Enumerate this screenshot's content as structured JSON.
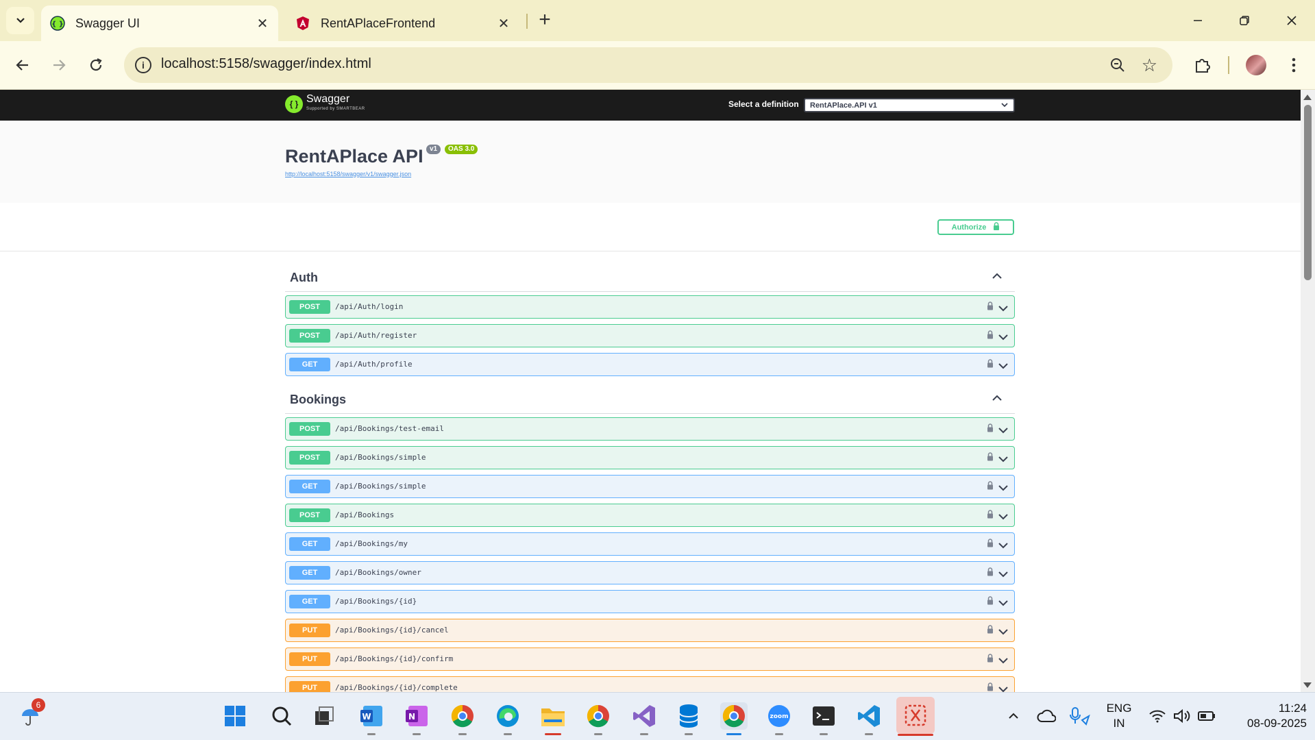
{
  "browser": {
    "tabs": [
      {
        "title": "Swagger UI",
        "active": true,
        "close": "✕"
      },
      {
        "title": "RentAPlaceFrontend",
        "active": false,
        "close": "✕"
      }
    ],
    "url": "localhost:5158/swagger/index.html",
    "new_tab": "+"
  },
  "swagger": {
    "logo_text": "Swagger",
    "logo_sub": "Supported by SMARTBEAR",
    "definition_label": "Select a definition",
    "definition_value": "RentAPlace.API v1",
    "api_title": "RentAPlace API",
    "version_badge": "v1",
    "oas_badge": "OAS 3.0",
    "spec_url": "http://localhost:5158/swagger/v1/swagger.json",
    "authorize_label": "Authorize"
  },
  "tags": [
    {
      "name": "Auth",
      "operations": [
        {
          "method": "POST",
          "path": "/api/Auth/login"
        },
        {
          "method": "POST",
          "path": "/api/Auth/register"
        },
        {
          "method": "GET",
          "path": "/api/Auth/profile"
        }
      ]
    },
    {
      "name": "Bookings",
      "operations": [
        {
          "method": "POST",
          "path": "/api/Bookings/test-email"
        },
        {
          "method": "POST",
          "path": "/api/Bookings/simple"
        },
        {
          "method": "GET",
          "path": "/api/Bookings/simple"
        },
        {
          "method": "POST",
          "path": "/api/Bookings"
        },
        {
          "method": "GET",
          "path": "/api/Bookings/my"
        },
        {
          "method": "GET",
          "path": "/api/Bookings/owner"
        },
        {
          "method": "GET",
          "path": "/api/Bookings/{id}"
        },
        {
          "method": "PUT",
          "path": "/api/Bookings/{id}/cancel"
        },
        {
          "method": "PUT",
          "path": "/api/Bookings/{id}/confirm"
        },
        {
          "method": "PUT",
          "path": "/api/Bookings/{id}/complete"
        }
      ]
    }
  ],
  "taskbar": {
    "weather_badge": "6",
    "lang_line1": "ENG",
    "lang_line2": "IN",
    "time": "11:24",
    "date": "08-09-2025"
  },
  "colors": {
    "post": "#49cc90",
    "get": "#61affe",
    "put": "#fca130",
    "swagger_green": "#85ea2d"
  }
}
